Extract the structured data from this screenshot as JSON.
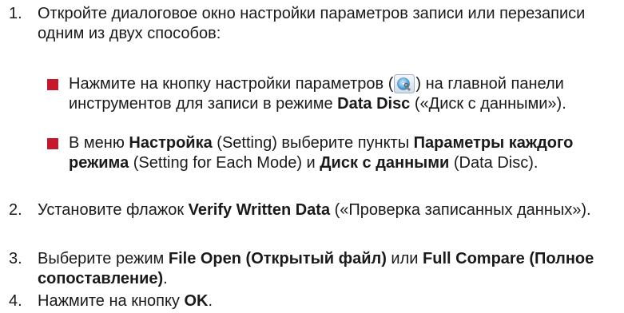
{
  "steps": [
    {
      "number": "1.",
      "text": "Откройте диалоговое окно настройки параметров записи или перезаписи одним из двух способов:",
      "substeps": [
        {
          "t1": "Нажмите на кнопку настройки параметров (",
          "icon": "settings-button-icon",
          "t2": ") на главной панели инструментов для записи в режиме ",
          "b1": "Data Disc",
          "t3": " («Диск с данными»)."
        },
        {
          "t1": "В меню ",
          "b1": "Настройка",
          "t2": " (Setting) выберите пункты ",
          "b2": "Параметры каждого режима",
          "t3": " (Setting for Each Mode) и ",
          "b3": "Диск с данными",
          "t4": " (Data Disc)."
        }
      ]
    },
    {
      "number": "2.",
      "t1": "Установите флажок ",
      "b1": "Verify Written Data",
      "t2": " («Проверка записанных данных»)."
    },
    {
      "number": "3.",
      "t1": "Выберите режим ",
      "b1": "File Open (Открытый файл)",
      "t2": " или ",
      "b2": "Full Compare (Полное сопоставление)",
      "t3": "."
    },
    {
      "number": "4.",
      "t1": "Нажмите на кнопку ",
      "b1": "OK",
      "t2": "."
    }
  ],
  "colors": {
    "bullet": "#c7172c",
    "text": "#1a1a1a"
  }
}
